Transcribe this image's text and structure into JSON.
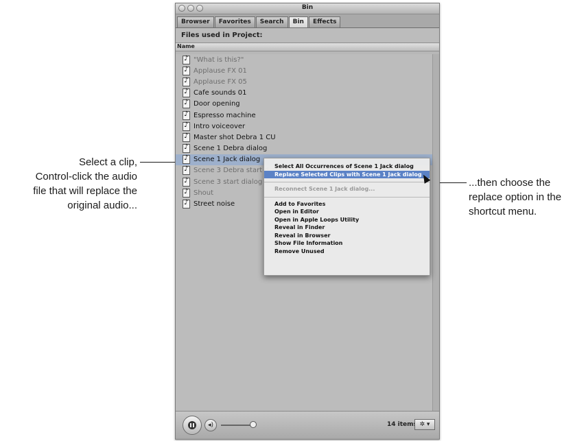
{
  "window": {
    "title": "Bin",
    "tabs": [
      "Browser",
      "Favorites",
      "Search",
      "Bin",
      "Effects"
    ],
    "active_tab": "Bin"
  },
  "panel": {
    "header": "Files used in Project:",
    "column_name": "Name"
  },
  "files": [
    {
      "name": "\"What is this?\"",
      "dimmed": true,
      "selected": false
    },
    {
      "name": "Applause FX 01",
      "dimmed": true,
      "selected": false
    },
    {
      "name": "Applause FX 05",
      "dimmed": true,
      "selected": false
    },
    {
      "name": "Cafe sounds 01",
      "dimmed": false,
      "selected": false
    },
    {
      "name": "Door opening",
      "dimmed": false,
      "selected": false
    },
    {
      "name": "Espresso machine",
      "dimmed": false,
      "selected": false
    },
    {
      "name": "Intro voiceover",
      "dimmed": false,
      "selected": false
    },
    {
      "name": "Master shot Debra 1 CU",
      "dimmed": false,
      "selected": false
    },
    {
      "name": "Scene 1 Debra dialog",
      "dimmed": false,
      "selected": false
    },
    {
      "name": "Scene 1 Jack dialog",
      "dimmed": false,
      "selected": true
    },
    {
      "name": "Scene 3 Debra start d",
      "dimmed": true,
      "selected": false
    },
    {
      "name": "Scene 3 start dialog",
      "dimmed": true,
      "selected": false
    },
    {
      "name": "Shout",
      "dimmed": true,
      "selected": false
    },
    {
      "name": "Street noise",
      "dimmed": false,
      "selected": false
    }
  ],
  "context_menu": {
    "group1": [
      {
        "label": "Select All Occurrences of Scene 1 Jack dialog",
        "state": "normal"
      },
      {
        "label": "Replace Selected Clips with Scene 1 Jack dialog",
        "state": "highlighted"
      }
    ],
    "group2": [
      {
        "label": "Reconnect Scene 1 Jack dialog...",
        "state": "disabled"
      }
    ],
    "group3": [
      {
        "label": "Add to Favorites",
        "state": "normal"
      },
      {
        "label": "Open in Editor",
        "state": "normal"
      },
      {
        "label": "Open in Apple Loops Utility",
        "state": "normal"
      },
      {
        "label": "Reveal in Finder",
        "state": "normal"
      },
      {
        "label": "Reveal in Browser",
        "state": "normal"
      },
      {
        "label": "Show File Information",
        "state": "normal"
      },
      {
        "label": "Remove Unused",
        "state": "normal"
      }
    ]
  },
  "bottom_bar": {
    "item_count": "14 items",
    "gear_label": "✲ ▾",
    "volume_icon": "◂)"
  },
  "callouts": {
    "left": [
      "Select a clip,",
      "Control-click the audio",
      "file that will replace the",
      "original audio..."
    ],
    "right": [
      "...then choose the",
      "replace option in the",
      "shortcut menu."
    ]
  },
  "colors": {
    "selection": "#9db0cc",
    "menu_highlight": "#5b82c6",
    "window_bg": "#bcbcbc"
  }
}
